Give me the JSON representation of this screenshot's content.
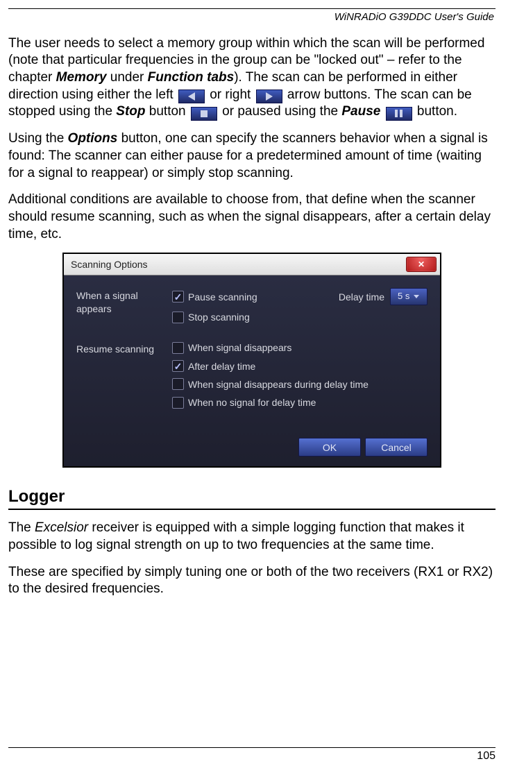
{
  "header": {
    "title": "WiNRADiO G39DDC User's Guide"
  },
  "para1": {
    "t1": "The user needs to select a memory group within which the scan will be performed (note that particular frequencies in the group can be \"locked out\" – refer to the chapter ",
    "b1": "Memory",
    "t2": " under ",
    "b2": "Function tabs",
    "t3": "). The scan can be performed in either direction using either the left ",
    "t4": " or right ",
    "t5": " arrow buttons. The scan can be stopped using the ",
    "b3": "Stop",
    "t6": " button ",
    "t7": " or paused using the ",
    "b4": "Pause",
    "t8": " button."
  },
  "para2": {
    "t1": "Using the ",
    "b1": "Options",
    "t2": " button, one can specify the scanners behavior when a signal is found: The scanner can either pause for a predetermined amount of time (waiting for a signal to reappear) or simply stop scanning."
  },
  "para3": "Additional conditions are available to choose from, that define when the scanner should resume scanning, such as when the signal disappears, after a certain delay time, etc.",
  "dialog": {
    "title": "Scanning Options",
    "group1_label": "When a signal appears",
    "opt_pause": "Pause scanning",
    "opt_stop": "Stop scanning",
    "delay_label": "Delay time",
    "delay_value": "5 s",
    "group2_label": "Resume scanning",
    "opt_r1": "When signal disappears",
    "opt_r2": "After delay time",
    "opt_r3": "When signal disappears during delay time",
    "opt_r4": "When no signal for delay time",
    "ok": "OK",
    "cancel": "Cancel"
  },
  "section": {
    "title": "Logger"
  },
  "para4": {
    "t1": "The ",
    "i1": "Excelsior",
    "t2": " receiver is equipped with a simple logging function that makes it possible to log signal strength on up to two frequencies at the same time."
  },
  "para5": "These are specified by simply tuning one or both of the two receivers (RX1 or RX2) to the desired frequencies.",
  "footer": {
    "page": "105"
  }
}
